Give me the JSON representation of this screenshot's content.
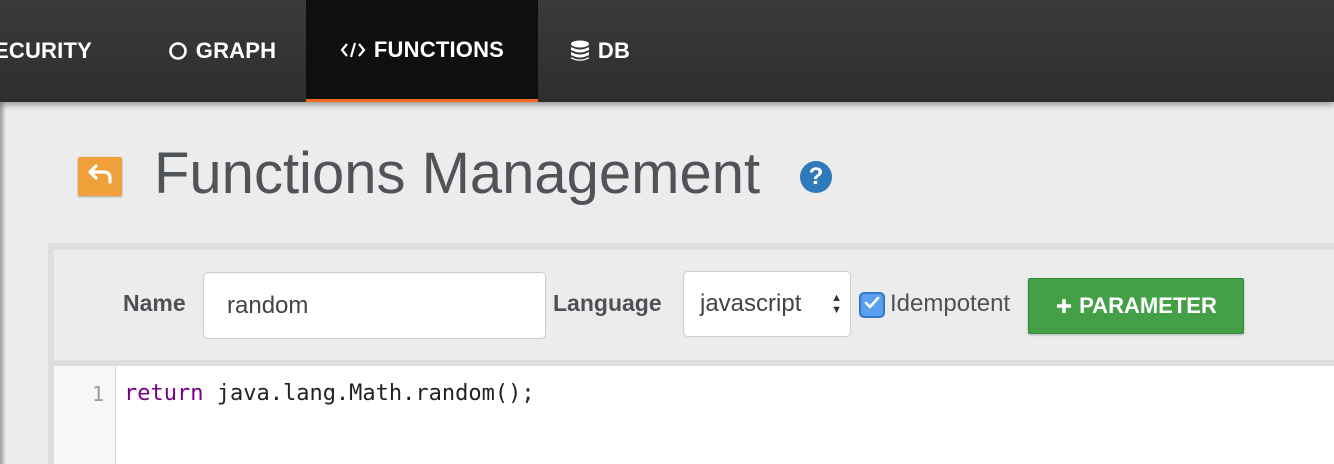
{
  "nav": {
    "items": [
      {
        "label": "ECURITY",
        "icon": "none"
      },
      {
        "label": "GRAPH",
        "icon": "circle-icon"
      },
      {
        "label": "FUNCTIONS",
        "icon": "code-icon"
      },
      {
        "label": "DB",
        "icon": "database-icon"
      }
    ],
    "active_color": "#f26b20"
  },
  "header": {
    "title": "Functions Management",
    "help_glyph": "?"
  },
  "form": {
    "name_label": "Name",
    "name_value": "random",
    "language_label": "Language",
    "language_value": "javascript",
    "idempotent_label": "Idempotent",
    "idempotent_checked": true,
    "parameter_button": "PARAMETER"
  },
  "editor": {
    "lines": [
      {
        "number": "1",
        "keyword": "return",
        "rest": " java.lang.Math.random();"
      }
    ]
  },
  "colors": {
    "button_green": "#43a047",
    "back_orange": "#f0a038",
    "help_blue": "#2f7ab8"
  }
}
